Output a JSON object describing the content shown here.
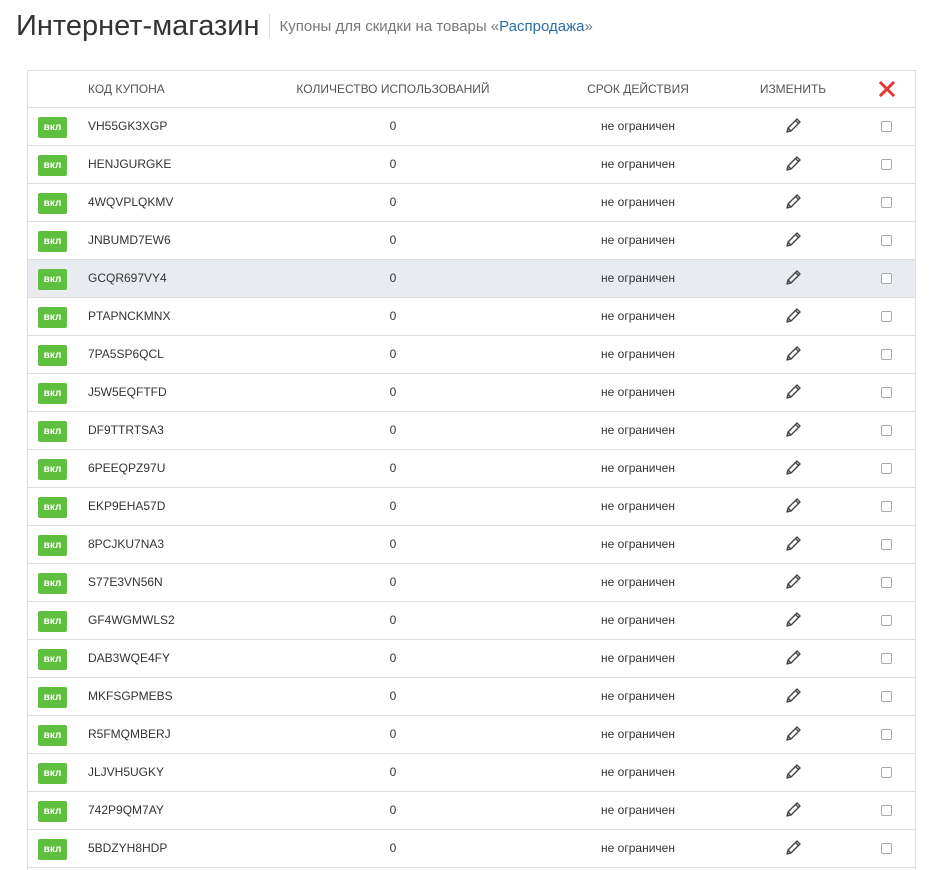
{
  "header": {
    "title": "Интернет-магазин",
    "subtitle_prefix": "Купоны для скидки на товары «",
    "subtitle_link": "Распродажа",
    "subtitle_suffix": "»"
  },
  "table": {
    "columns": {
      "code": "КОД КУПОНА",
      "uses": "КОЛИЧЕСТВО ИСПОЛЬЗОВАНИЙ",
      "expiry": "СРОК ДЕЙСТВИЯ",
      "edit": "ИЗМЕНИТЬ"
    },
    "icons": {
      "delete": "close-icon",
      "edit": "pencil-icon"
    },
    "colors": {
      "status_on": "#5fbf3f",
      "delete": "#e53935",
      "hover_row": "#e8ecf1",
      "link": "#2a6fa8"
    },
    "rows": [
      {
        "status": "вкл",
        "code": "VH55GK3XGP",
        "uses": "0",
        "expiry": "не ограничен"
      },
      {
        "status": "вкл",
        "code": "HENJGURGKE",
        "uses": "0",
        "expiry": "не ограничен"
      },
      {
        "status": "вкл",
        "code": "4WQVPLQKMV",
        "uses": "0",
        "expiry": "не ограничен"
      },
      {
        "status": "вкл",
        "code": "JNBUMD7EW6",
        "uses": "0",
        "expiry": "не ограничен"
      },
      {
        "status": "вкл",
        "code": "GCQR697VY4",
        "uses": "0",
        "expiry": "не ограничен"
      },
      {
        "status": "вкл",
        "code": "PTAPNCKMNX",
        "uses": "0",
        "expiry": "не ограничен"
      },
      {
        "status": "вкл",
        "code": "7PA5SP6QCL",
        "uses": "0",
        "expiry": "не ограничен"
      },
      {
        "status": "вкл",
        "code": "J5W5EQFTFD",
        "uses": "0",
        "expiry": "не ограничен"
      },
      {
        "status": "вкл",
        "code": "DF9TTRTSA3",
        "uses": "0",
        "expiry": "не ограничен"
      },
      {
        "status": "вкл",
        "code": "6PEEQPZ97U",
        "uses": "0",
        "expiry": "не ограничен"
      },
      {
        "status": "вкл",
        "code": "EKP9EHA57D",
        "uses": "0",
        "expiry": "не ограничен"
      },
      {
        "status": "вкл",
        "code": "8PCJKU7NA3",
        "uses": "0",
        "expiry": "не ограничен"
      },
      {
        "status": "вкл",
        "code": "S77E3VN56N",
        "uses": "0",
        "expiry": "не ограничен"
      },
      {
        "status": "вкл",
        "code": "GF4WGMWLS2",
        "uses": "0",
        "expiry": "не ограничен"
      },
      {
        "status": "вкл",
        "code": "DAB3WQE4FY",
        "uses": "0",
        "expiry": "не ограничен"
      },
      {
        "status": "вкл",
        "code": "MKFSGPMEBS",
        "uses": "0",
        "expiry": "не ограничен"
      },
      {
        "status": "вкл",
        "code": "R5FMQMBERJ",
        "uses": "0",
        "expiry": "не ограничен"
      },
      {
        "status": "вкл",
        "code": "JLJVH5UGKY",
        "uses": "0",
        "expiry": "не ограничен"
      },
      {
        "status": "вкл",
        "code": "742P9QM7AY",
        "uses": "0",
        "expiry": "не ограничен"
      },
      {
        "status": "вкл",
        "code": "5BDZYH8HDP",
        "uses": "0",
        "expiry": "не ограничен"
      }
    ]
  }
}
